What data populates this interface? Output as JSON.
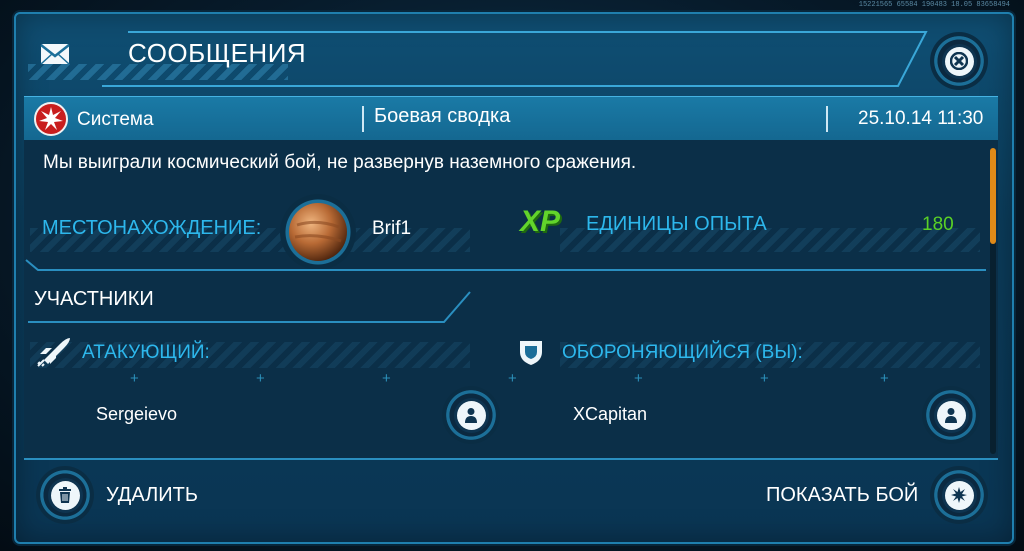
{
  "hud_text": "15221565 65584 190483 18.05 83658494",
  "header": {
    "title": "СООБЩЕНИЯ",
    "mail_icon": "envelope-icon",
    "close_icon": "close-icon"
  },
  "message": {
    "sender": "Система",
    "subject": "Боевая сводка",
    "datetime": "25.10.14 11:30",
    "body": "Мы выиграли космический бой, не развернув наземного сражения."
  },
  "location": {
    "label": "МЕСТОНАХОЖДЕНИЕ:",
    "planet": "Brif1"
  },
  "experience": {
    "icon_text": "XP",
    "label": "ЕДИНИЦЫ ОПЫТА",
    "value": "180"
  },
  "participants": {
    "heading": "УЧАСТНИКИ",
    "attacker": {
      "label": "АТАКУЮЩИЙ:",
      "name": "Sergeievo"
    },
    "defender": {
      "label": "ОБОРОНЯЮЩИЙСЯ (ВЫ):",
      "name": "XCapitan"
    }
  },
  "footer": {
    "delete_label": "УДАЛИТЬ",
    "show_battle_label": "ПОКАЗАТЬ БОЙ"
  },
  "scroll": {
    "position": 0
  },
  "colors": {
    "accent": "#2db7ec",
    "xp_value": "#5ad126",
    "scroll_thumb": "#e08a18"
  }
}
